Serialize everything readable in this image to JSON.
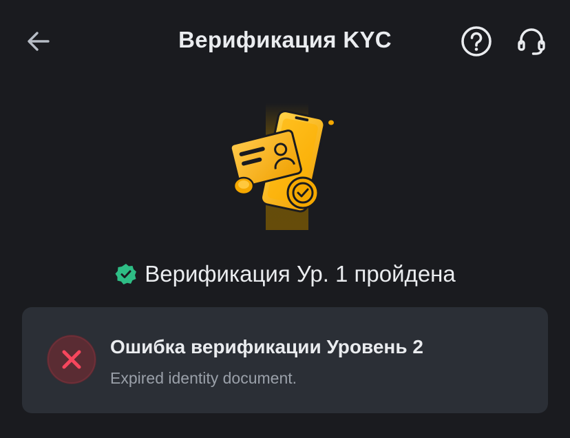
{
  "header": {
    "title": "Верификация KYC",
    "back_icon": "arrow-left-icon",
    "help_icon": "question-circle-icon",
    "support_icon": "headset-icon"
  },
  "illustration": {
    "icon": "kyc-phone-id-card-illustration"
  },
  "status": {
    "text": "Верификация Ур. 1 пройдена",
    "icon": "verified-badge-icon",
    "color": "#2ebd85"
  },
  "error_card": {
    "title": "Ошибка верификации Уровень 2",
    "message": "Expired identity document.",
    "icon": "error-x-icon",
    "color": "#f6465d"
  },
  "colors": {
    "background": "#1a1b1f",
    "card": "#2b2f36",
    "accent": "#f0b90b",
    "text_primary": "#eaecef",
    "text_secondary": "#9aa0a9"
  }
}
